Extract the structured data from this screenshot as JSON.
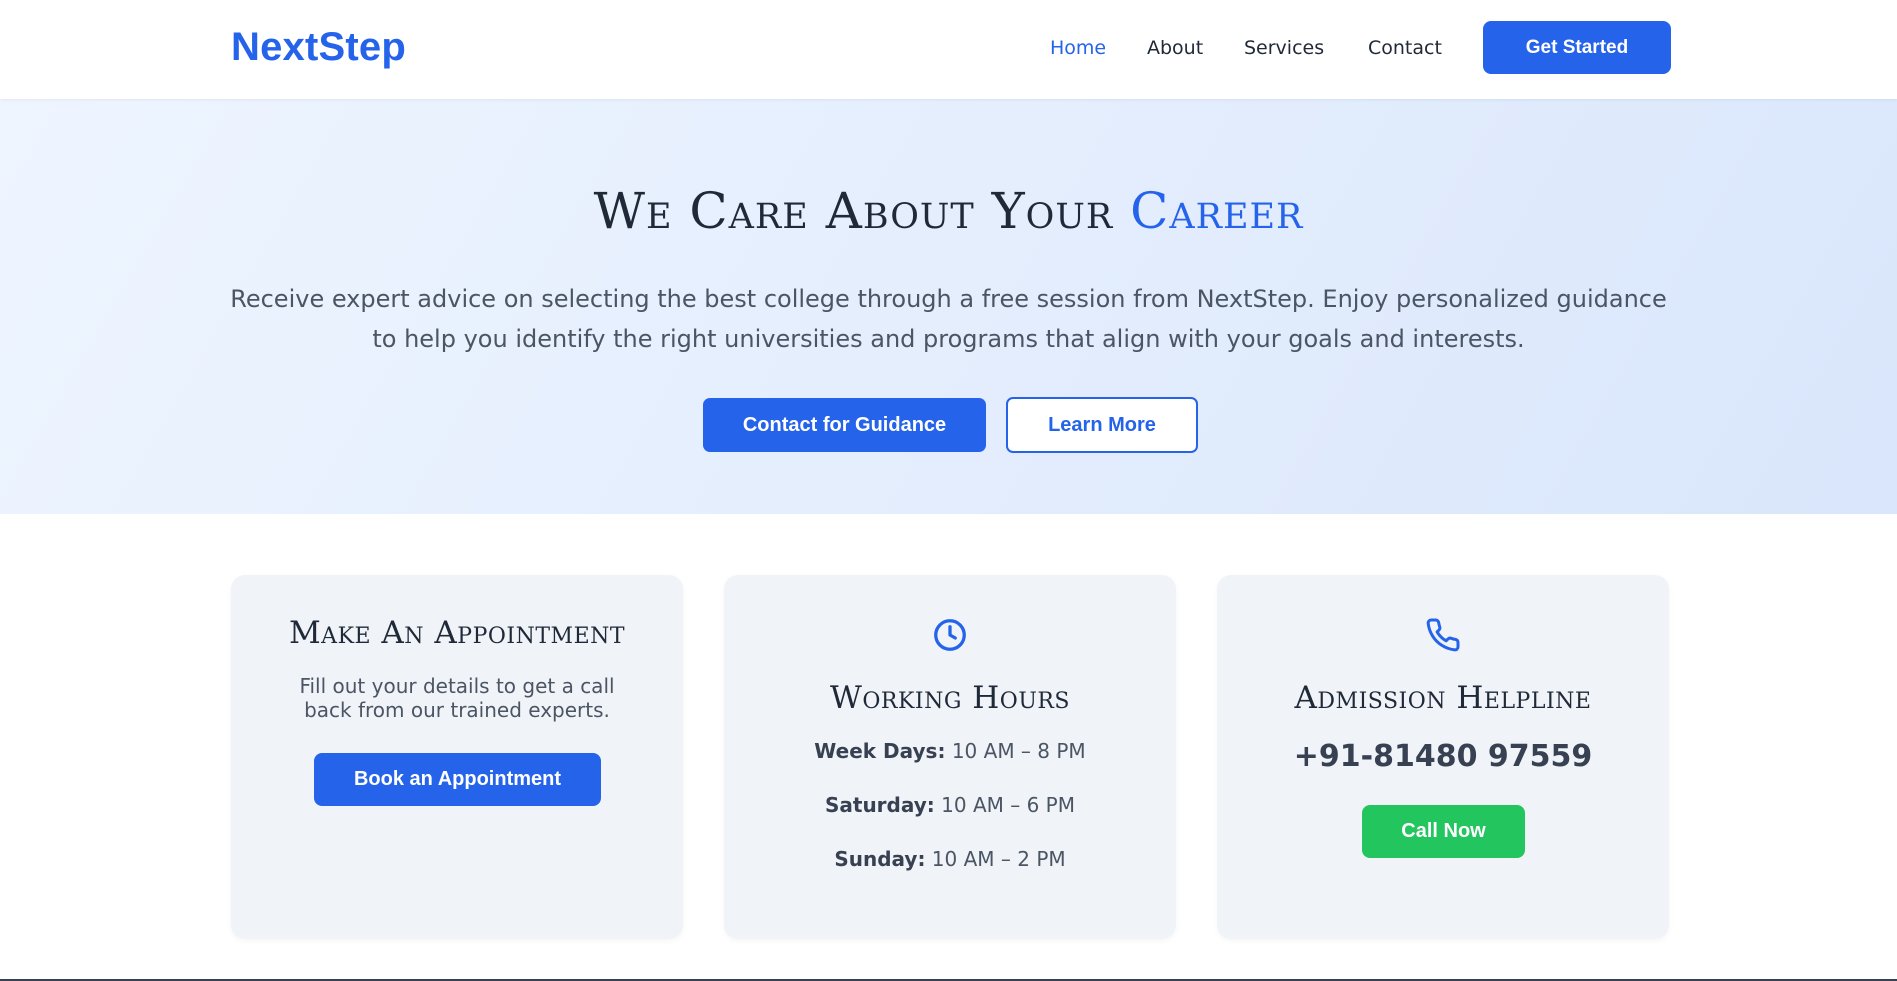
{
  "header": {
    "logo": "NextStep",
    "nav": [
      {
        "label": "Home",
        "active": true
      },
      {
        "label": "About",
        "active": false
      },
      {
        "label": "Services",
        "active": false
      },
      {
        "label": "Contact",
        "active": false
      }
    ],
    "cta_label": "Get Started"
  },
  "hero": {
    "title_main": "We Care About Your ",
    "title_accent": "Career",
    "description": "Receive expert advice on selecting the best college through a free session from NextStep. Enjoy personalized guidance to help you identify the right universities and programs that align with your goals and interests.",
    "primary_button": "Contact for Guidance",
    "secondary_button": "Learn More"
  },
  "cards": {
    "appointment": {
      "title": "Make An Appointment",
      "description": "Fill out your details to get a call back from our trained experts.",
      "button": "Book an Appointment"
    },
    "hours": {
      "icon": "clock-icon",
      "title": "Working Hours",
      "rows": [
        {
          "day": "Week Days:",
          "time": " 10 AM – 8 PM"
        },
        {
          "day": "Saturday:",
          "time": " 10 AM – 6 PM"
        },
        {
          "day": "Sunday:",
          "time": " 10 AM – 2 PM"
        }
      ]
    },
    "helpline": {
      "icon": "phone-icon",
      "title": "Admission Helpline",
      "phone": "+91-81480 97559",
      "button": "Call Now"
    }
  },
  "colors": {
    "brand": "#2563eb",
    "call_button": "#22c55e",
    "hero_bg": "#e3edfd",
    "card_bg": "#f0f4f9"
  }
}
